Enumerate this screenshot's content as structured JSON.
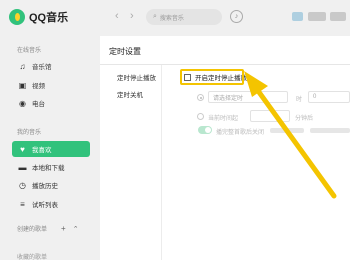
{
  "app": {
    "name": "QQ音乐"
  },
  "sidebar": {
    "section_online": "在线音乐",
    "online_items": [
      {
        "label": "音乐馆",
        "icon": "music-note-icon"
      },
      {
        "label": "视频",
        "icon": "video-icon"
      },
      {
        "label": "电台",
        "icon": "radio-icon"
      }
    ],
    "section_mine": "我的音乐",
    "mine_items": [
      {
        "label": "我喜欢",
        "icon": "heart-icon",
        "active": true
      },
      {
        "label": "本地和下载",
        "icon": "monitor-icon"
      },
      {
        "label": "播放历史",
        "icon": "history-icon"
      },
      {
        "label": "试听列表",
        "icon": "playlist-icon"
      }
    ],
    "section_created": "创建的歌单",
    "section_collected": "收藏的歌单"
  },
  "topbar": {
    "search_placeholder": "搜索音乐"
  },
  "settings": {
    "title": "定时设置",
    "subnav": [
      "定时停止播放",
      "定时关机"
    ],
    "enable_option": {
      "label": "开启定时停止播放",
      "checked": false
    },
    "disabled_rows": {
      "time_select_placeholder": "请选择定时",
      "hour_unit": "时",
      "hour_value": "0",
      "relative_label": "当前时间起",
      "minute_unit": "分钟后",
      "finish_song_label": "播完整首歌后关闭"
    }
  },
  "colors": {
    "brand": "#31c27c",
    "highlight": "#f4c400",
    "arrow": "#f4c400"
  }
}
